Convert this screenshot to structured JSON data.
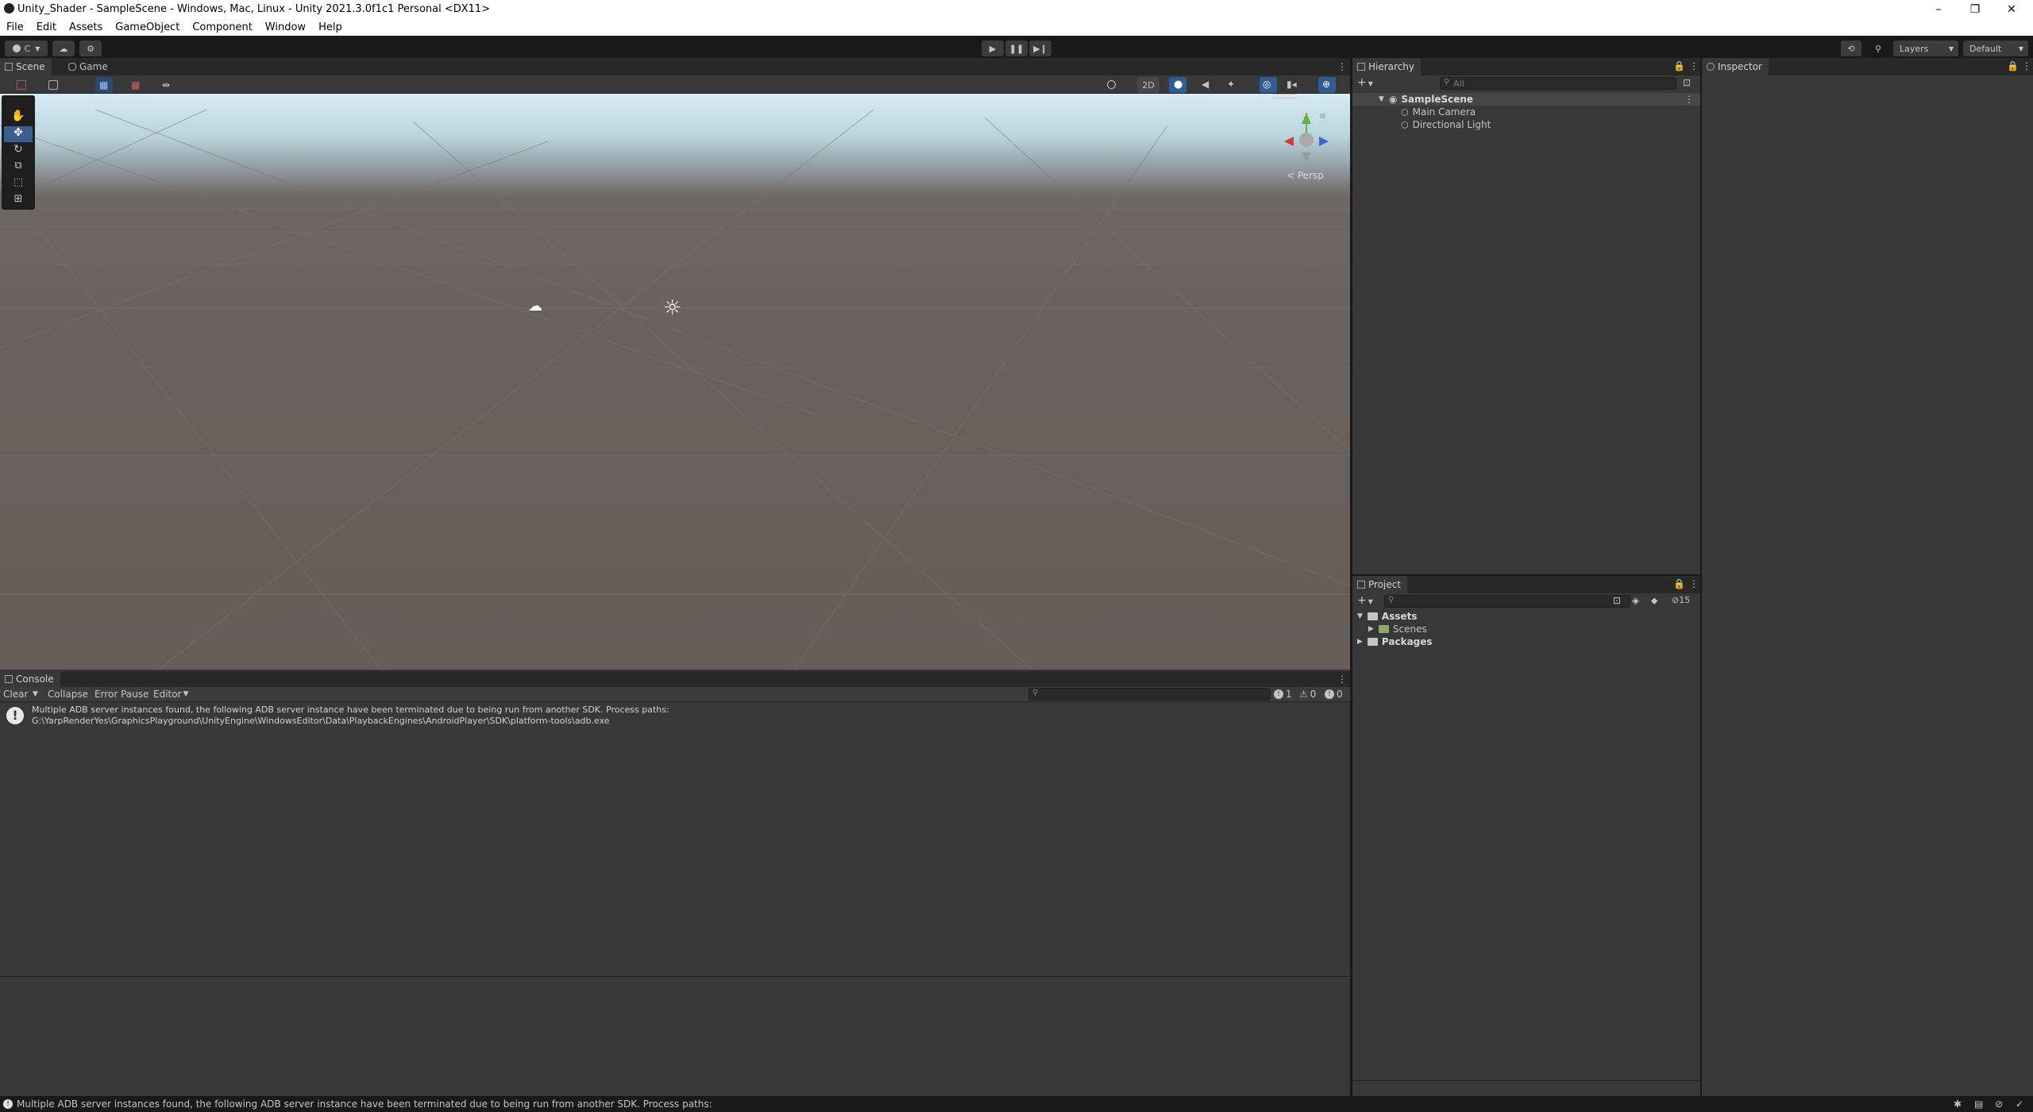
{
  "window": {
    "title": "Unity_Shader - SampleScene - Windows, Mac, Linux - Unity 2021.3.0f1c1 Personal <DX11>",
    "minimize": "–",
    "restore": "❐",
    "close": "✕"
  },
  "menu": [
    "File",
    "Edit",
    "Assets",
    "GameObject",
    "Component",
    "Window",
    "Help"
  ],
  "toolbar": {
    "account_label": "C",
    "layers_label": "Layers",
    "layout_label": "Default"
  },
  "scene_tabs": {
    "scene": "Scene",
    "game": "Game"
  },
  "scene_toolbar": {
    "twod": "2D"
  },
  "scene_view": {
    "persp_label": "< Persp"
  },
  "console": {
    "tab": "Console",
    "clear": "Clear",
    "collapse": "Collapse",
    "error_pause": "Error Pause",
    "editor": "Editor",
    "count_logs": "1",
    "count_warnings": "0",
    "count_errors": "0",
    "messages": [
      {
        "line1": "Multiple ADB server instances found, the following ADB server instance have been terminated due to being run from another SDK. Process paths:",
        "line2": "G:\\YarpRenderYes\\GraphicsPlayground\\UnityEngine\\WindowsEditor\\Data\\PlaybackEngines\\AndroidPlayer\\SDK\\platform-tools\\adb.exe"
      }
    ]
  },
  "hierarchy": {
    "tab": "Hierarchy",
    "search_placeholder": "All",
    "scene": "SampleScene",
    "items": [
      "Main Camera",
      "Directional Light"
    ]
  },
  "project": {
    "tab": "Project",
    "hidden_count": "15",
    "tree": {
      "assets": "Assets",
      "scenes": "Scenes",
      "packages": "Packages"
    }
  },
  "inspector": {
    "tab": "Inspector"
  },
  "status": {
    "message": "Multiple ADB server instances found, the following ADB server instance have been terminated due to being run from another SDK. Process paths:"
  },
  "colors": {
    "accent": "#3a72b0",
    "panel_bg": "#383838",
    "toolbar_bg": "#191919"
  }
}
